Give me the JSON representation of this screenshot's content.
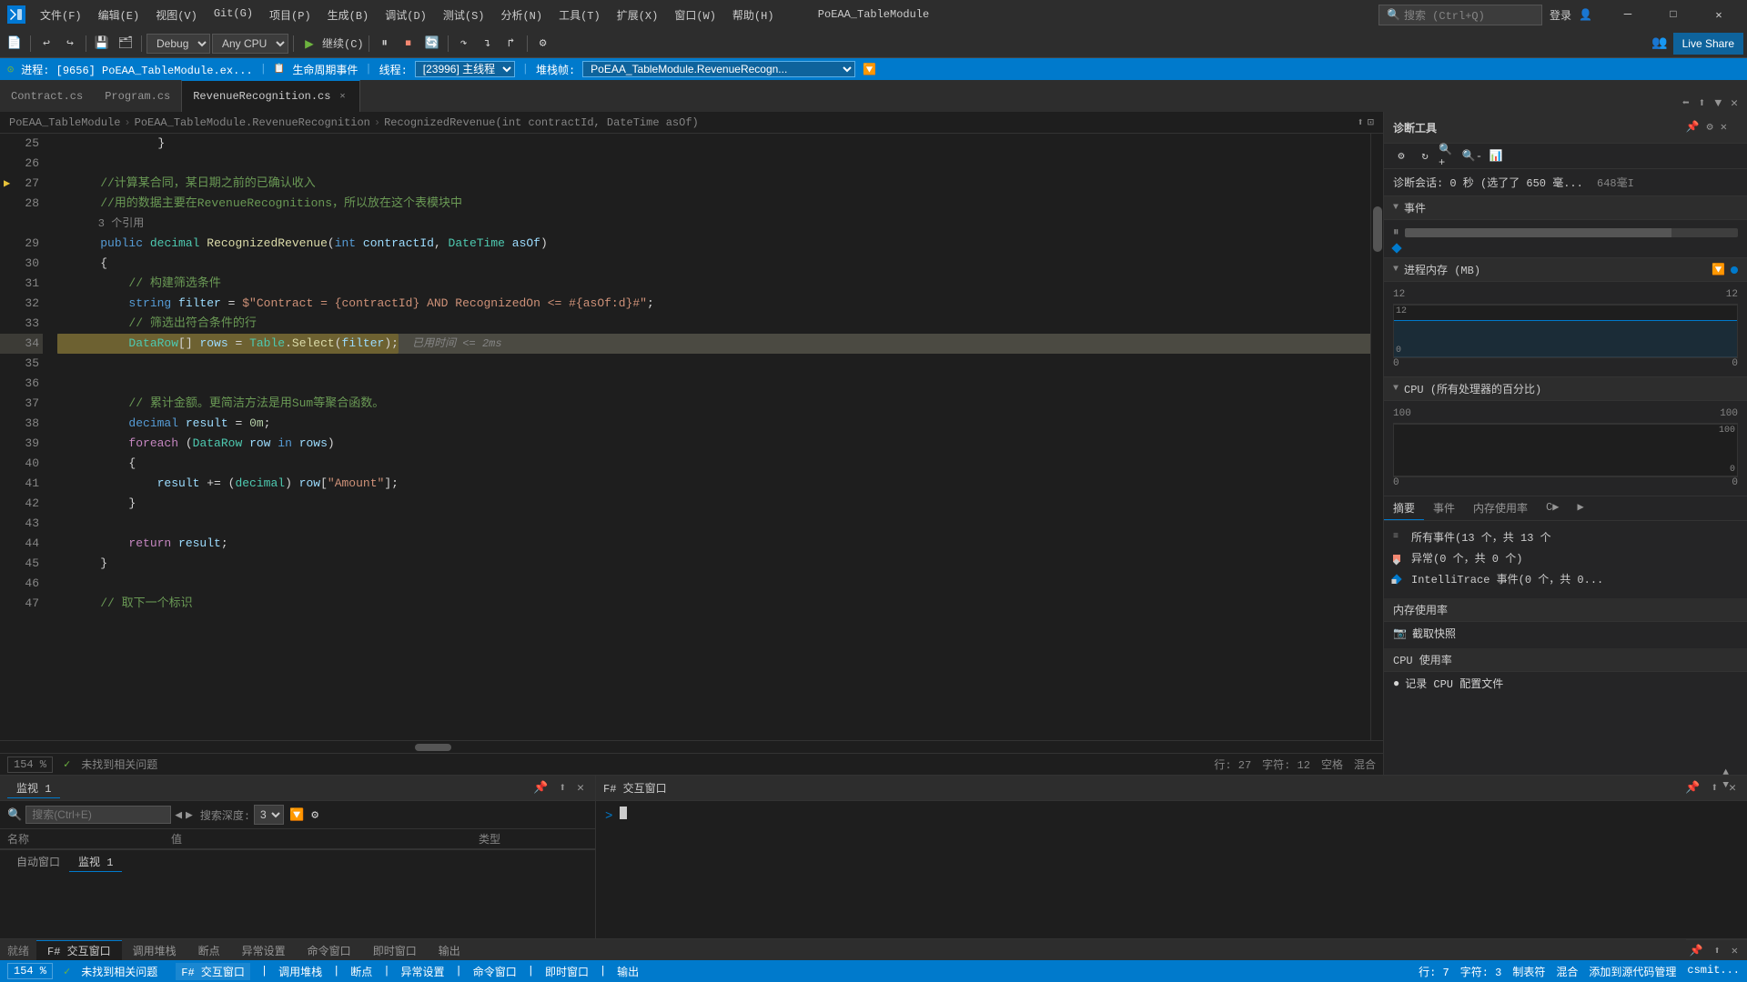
{
  "titlebar": {
    "logo": "VS",
    "menus": [
      "文件(F)",
      "编辑(E)",
      "视图(V)",
      "Git(G)",
      "项目(P)",
      "生成(B)",
      "调试(D)",
      "测试(S)",
      "分析(N)",
      "工具(T)",
      "扩展(X)",
      "窗口(W)",
      "帮助(H)"
    ],
    "search": "搜索 (Ctrl+Q)",
    "title": "PoEAA_TableModule",
    "login": "登录",
    "live_share": "Live Share",
    "window_min": "—",
    "window_max": "□",
    "window_close": "✕"
  },
  "toolbar": {
    "debug_mode": "Debug",
    "cpu": "Any CPU",
    "play_label": "继续(C)",
    "live_share_label": "Live Share"
  },
  "debug_bar": {
    "process": "进程: [9656] PoEAA_TableModule.ex...",
    "lifecycle": "生命周期事件",
    "thread": "线程: [23996] 主线程",
    "stack": "堆栈帧: PoEAA_TableModule.RevenueRecogn..."
  },
  "tabs": {
    "items": [
      {
        "label": "Contract.cs",
        "active": false,
        "modified": false
      },
      {
        "label": "Program.cs",
        "active": false,
        "modified": false
      },
      {
        "label": "RevenueRecognition.cs",
        "active": true,
        "modified": false
      }
    ],
    "split_buttons": [
      "⬅",
      "➡",
      "▲",
      "▼"
    ]
  },
  "breadcrumb": {
    "project": "PoEAA_TableModule",
    "file": "PoEAA_TableModule.RevenueRecognition",
    "method": "RecognizedRevenue(int contractId, DateTime asOf)"
  },
  "code": {
    "lines": [
      {
        "num": 25,
        "content": "        }",
        "indent": 0,
        "type": "normal"
      },
      {
        "num": 26,
        "content": "",
        "indent": 0,
        "type": "normal"
      },
      {
        "num": 27,
        "content": "    //计算某合同，某日期之前的已确认收入",
        "indent": 0,
        "type": "normal",
        "fold": true,
        "breakpoint_arrow": true
      },
      {
        "num": 28,
        "content": "    //用的数据主要在RevenueRecognitions，所以放在这个表模块中",
        "indent": 0,
        "type": "normal"
      },
      {
        "num": "28b",
        "content": "    3 个引用",
        "indent": 0,
        "type": "reference"
      },
      {
        "num": 29,
        "content": "    public decimal RecognizedRevenue(int contractId, DateTime asOf)",
        "indent": 0,
        "type": "normal",
        "fold": true
      },
      {
        "num": 30,
        "content": "    {",
        "indent": 0,
        "type": "normal"
      },
      {
        "num": 31,
        "content": "        // 构建筛选条件",
        "indent": 0,
        "type": "normal"
      },
      {
        "num": 32,
        "content": "        string filter = $\"Contract = {contractId} AND RecognizedOn <= #{asOf:d}#\";",
        "indent": 0,
        "type": "normal"
      },
      {
        "num": 33,
        "content": "        // 筛选出符合条件的行",
        "indent": 0,
        "type": "normal"
      },
      {
        "num": 34,
        "content": "        DataRow[] rows = Table.Select(filter);",
        "indent": 0,
        "type": "highlighted",
        "debug_arrow": true,
        "hint": " 已用时间 <= 2ms"
      },
      {
        "num": 35,
        "content": "",
        "indent": 0,
        "type": "normal"
      },
      {
        "num": 36,
        "content": "",
        "indent": 0,
        "type": "normal"
      },
      {
        "num": 37,
        "content": "        // 累计金额。更简洁方法是用Sum等聚合函数。",
        "indent": 0,
        "type": "normal"
      },
      {
        "num": 38,
        "content": "        decimal result = 0m;",
        "indent": 0,
        "type": "normal"
      },
      {
        "num": 39,
        "content": "        foreach (DataRow row in rows)",
        "indent": 0,
        "type": "normal",
        "fold": true
      },
      {
        "num": 40,
        "content": "        {",
        "indent": 0,
        "type": "normal"
      },
      {
        "num": 41,
        "content": "            result += (decimal) row[\"Amount\"];",
        "indent": 0,
        "type": "normal"
      },
      {
        "num": 42,
        "content": "        }",
        "indent": 0,
        "type": "normal"
      },
      {
        "num": 43,
        "content": "",
        "indent": 0,
        "type": "normal"
      },
      {
        "num": 44,
        "content": "        return result;",
        "indent": 0,
        "type": "normal"
      },
      {
        "num": 45,
        "content": "    }",
        "indent": 0,
        "type": "normal"
      },
      {
        "num": 46,
        "content": "",
        "indent": 0,
        "type": "normal"
      },
      {
        "num": 47,
        "content": "    // 取下一个标识",
        "indent": 0,
        "type": "normal"
      }
    ]
  },
  "diagnostics": {
    "panel_title": "诊断工具",
    "session_info": "诊断会话: 0 秒 (选了了 650 毫...",
    "session_detail": "648毫I",
    "events_section": "事件",
    "memory_section": "进程内存 (MB)",
    "cpu_section": "CPU (所有处理器的百分比)",
    "memory_labels": {
      "left_min": "12",
      "right_min": "12",
      "left_max": "0",
      "right_max": "0"
    },
    "cpu_labels": {
      "left_max": "100",
      "right_max": "100",
      "left_min": "0",
      "right_min": "0"
    },
    "tabs": [
      "摘要",
      "事件",
      "内存使用率",
      "C▶",
      "▶"
    ],
    "events_tab": {
      "label": "事件",
      "items": [
        {
          "label": "所有事件(13 个，共 13 个",
          "type": "lines",
          "color": "#858585"
        },
        {
          "label": "异常(0 个，共 0 个)",
          "type": "dot",
          "color": "#f48771"
        },
        {
          "label": "IntelliTrace 事件(0 个，共 0...",
          "type": "diamond",
          "color": "#007acc"
        }
      ]
    },
    "memory_use": "内存使用率",
    "capture_screenshot": "截取快照",
    "cpu_use": "CPU 使用率",
    "record_cpu": "记录 CPU 配置文件"
  },
  "bottom": {
    "watch_panel": {
      "title": "监视 1",
      "tabs": [
        "自动窗口",
        "监视 1"
      ],
      "search_placeholder": "搜索(Ctrl+E)",
      "search_depth": "3",
      "columns": [
        "名称",
        "值",
        "类型"
      ]
    },
    "interactive_panel": {
      "title": "F# 交互窗口",
      "prompt": ">"
    }
  },
  "bottom_tab_bar": {
    "tabs": [
      "F# 交互窗口",
      "调用堆栈",
      "断点",
      "异常设置",
      "命令窗口",
      "即时窗口",
      "输出"
    ]
  },
  "status_bar": {
    "zoom": "154 %",
    "status": "未找到相关问题",
    "line": "行: 27",
    "char": "字符: 12",
    "spaces": "空格",
    "encoding": "混合",
    "git": "添加到源代码管理",
    "profile": "csmit..."
  },
  "status_bar2": {
    "zoom": "154 %",
    "status": "未找到相关问题",
    "line": "行: 7",
    "char": "字符: 3",
    "format": "制表符",
    "encoding": "混合",
    "panel_tab": "F# 交互窗口"
  }
}
